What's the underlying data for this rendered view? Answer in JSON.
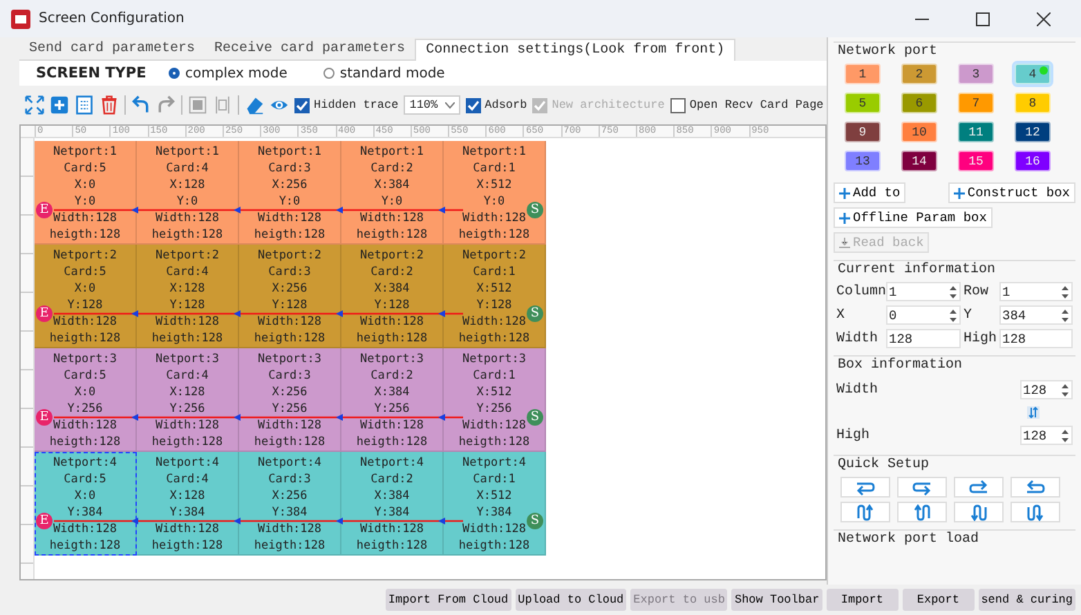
{
  "window": {
    "title": "Screen Configuration"
  },
  "tabs": [
    {
      "label": "Send card parameters",
      "selected": false
    },
    {
      "label": "Receive card parameters",
      "selected": false
    },
    {
      "label": "Connection settings(Look from front)",
      "selected": true
    }
  ],
  "screen_type": {
    "label": "SCREEN TYPE",
    "options": [
      {
        "label": "complex mode",
        "selected": true
      },
      {
        "label": "standard mode",
        "selected": false
      }
    ]
  },
  "toolbar": {
    "tools": [
      {
        "kind": "fit",
        "disabled": false
      },
      {
        "kind": "add",
        "disabled": false
      },
      {
        "kind": "grid",
        "disabled": false
      },
      {
        "kind": "delete",
        "disabled": false
      },
      {
        "kind": "undo",
        "disabled": false
      },
      {
        "kind": "redo",
        "disabled": true
      },
      {
        "kind": "align",
        "disabled": true
      },
      {
        "kind": "distribute",
        "disabled": true
      },
      {
        "kind": "eraser",
        "disabled": false
      },
      {
        "kind": "eye",
        "disabled": false
      }
    ],
    "options": [
      {
        "kind": "checkbox",
        "label": "Hidden trace",
        "checked": true,
        "disabled": false
      },
      {
        "kind": "select",
        "value": "110%"
      },
      {
        "kind": "checkbox",
        "label": "Adsorb",
        "checked": true,
        "disabled": false
      },
      {
        "kind": "checkbox",
        "label": "New architecture",
        "checked": true,
        "disabled": true
      },
      {
        "kind": "checkbox",
        "label": "Open Recv Card Page",
        "checked": false,
        "disabled": false
      }
    ]
  },
  "ruler": {
    "ticks": [
      "0",
      "50",
      "100",
      "150",
      "200",
      "250",
      "300",
      "350",
      "400",
      "450",
      "500",
      "550",
      "600",
      "650",
      "700",
      "750",
      "800",
      "850",
      "900",
      "950"
    ]
  },
  "canvas": {
    "rows": [
      {
        "color": "#fc9c69",
        "start": "S",
        "end": "E",
        "cells": [
          {
            "lines": [
              "Netport:1",
              "Card:5",
              "X:0",
              "Y:0",
              "Width:128",
              "heigth:128"
            ],
            "selected": false
          },
          {
            "lines": [
              "Netport:1",
              "Card:4",
              "X:128",
              "Y:0",
              "Width:128",
              "heigth:128"
            ],
            "selected": false
          },
          {
            "lines": [
              "Netport:1",
              "Card:3",
              "X:256",
              "Y:0",
              "Width:128",
              "heigth:128"
            ],
            "selected": false
          },
          {
            "lines": [
              "Netport:1",
              "Card:2",
              "X:384",
              "Y:0",
              "Width:128",
              "heigth:128"
            ],
            "selected": false
          },
          {
            "lines": [
              "Netport:1",
              "Card:1",
              "X:512",
              "Y:0",
              "Width:128",
              "heigth:128"
            ],
            "selected": false
          }
        ]
      },
      {
        "color": "#cc9933",
        "start": "S",
        "end": "E",
        "cells": [
          {
            "lines": [
              "Netport:2",
              "Card:5",
              "X:0",
              "Y:128",
              "Width:128",
              "heigth:128"
            ],
            "selected": false
          },
          {
            "lines": [
              "Netport:2",
              "Card:4",
              "X:128",
              "Y:128",
              "Width:128",
              "heigth:128"
            ],
            "selected": false
          },
          {
            "lines": [
              "Netport:2",
              "Card:3",
              "X:256",
              "Y:128",
              "Width:128",
              "heigth:128"
            ],
            "selected": false
          },
          {
            "lines": [
              "Netport:2",
              "Card:2",
              "X:384",
              "Y:128",
              "Width:128",
              "heigth:128"
            ],
            "selected": false
          },
          {
            "lines": [
              "Netport:2",
              "Card:1",
              "X:512",
              "Y:128",
              "Width:128",
              "heigth:128"
            ],
            "selected": false
          }
        ]
      },
      {
        "color": "#cc99cc",
        "start": "S",
        "end": "E",
        "cells": [
          {
            "lines": [
              "Netport:3",
              "Card:5",
              "X:0",
              "Y:256",
              "Width:128",
              "heigth:128"
            ],
            "selected": false
          },
          {
            "lines": [
              "Netport:3",
              "Card:4",
              "X:128",
              "Y:256",
              "Width:128",
              "heigth:128"
            ],
            "selected": false
          },
          {
            "lines": [
              "Netport:3",
              "Card:3",
              "X:256",
              "Y:256",
              "Width:128",
              "heigth:128"
            ],
            "selected": false
          },
          {
            "lines": [
              "Netport:3",
              "Card:2",
              "X:384",
              "Y:256",
              "Width:128",
              "heigth:128"
            ],
            "selected": false
          },
          {
            "lines": [
              "Netport:3",
              "Card:1",
              "X:512",
              "Y:256",
              "Width:128",
              "heigth:128"
            ],
            "selected": false
          }
        ]
      },
      {
        "color": "#66cccc",
        "start": "S",
        "end": "E",
        "cells": [
          {
            "lines": [
              "Netport:4",
              "Card:5",
              "X:0",
              "Y:384",
              "Width:128",
              "heigth:128"
            ],
            "selected": true
          },
          {
            "lines": [
              "Netport:4",
              "Card:4",
              "X:128",
              "Y:384",
              "Width:128",
              "heigth:128"
            ],
            "selected": false
          },
          {
            "lines": [
              "Netport:4",
              "Card:3",
              "X:256",
              "Y:384",
              "Width:128",
              "heigth:128"
            ],
            "selected": false
          },
          {
            "lines": [
              "Netport:4",
              "Card:2",
              "X:384",
              "Y:384",
              "Width:128",
              "heigth:128"
            ],
            "selected": false
          },
          {
            "lines": [
              "Netport:4",
              "Card:1",
              "X:512",
              "Y:384",
              "Width:128",
              "heigth:128"
            ],
            "selected": false
          }
        ]
      }
    ]
  },
  "network_port": {
    "title": "Network port",
    "ports": [
      {
        "label": "1",
        "color": "#ff9966",
        "selected": false
      },
      {
        "label": "2",
        "color": "#cc9933",
        "selected": false
      },
      {
        "label": "3",
        "color": "#cc99cc",
        "selected": false
      },
      {
        "label": "4",
        "color": "#66cccc",
        "selected": true
      },
      {
        "label": "5",
        "color": "#99cc00",
        "selected": false
      },
      {
        "label": "6",
        "color": "#999900",
        "selected": false
      },
      {
        "label": "7",
        "color": "#ff9900",
        "selected": false
      },
      {
        "label": "8",
        "color": "#ffcc00",
        "selected": false
      },
      {
        "label": "9",
        "color": "#7f3f3f",
        "selected": false
      },
      {
        "label": "10",
        "color": "#ff7f3f",
        "selected": false
      },
      {
        "label": "11",
        "color": "#007f7f",
        "selected": false
      },
      {
        "label": "12",
        "color": "#003f7f",
        "selected": false
      },
      {
        "label": "13",
        "color": "#7f7fff",
        "selected": false
      },
      {
        "label": "14",
        "color": "#7f003f",
        "selected": false
      },
      {
        "label": "15",
        "color": "#ff007f",
        "selected": false
      },
      {
        "label": "16",
        "color": "#7f00ff",
        "selected": false
      }
    ],
    "buttons": [
      {
        "label": "Add to",
        "kind": "plus",
        "disabled": false
      },
      {
        "label": "Construct box",
        "kind": "plus",
        "disabled": false
      },
      {
        "label": "Offline Param box",
        "kind": "plus",
        "disabled": false
      },
      {
        "label": "Read back",
        "kind": "download",
        "disabled": true
      }
    ]
  },
  "current_information": {
    "title": "Current information",
    "fields": [
      {
        "label": "Column",
        "value": "1",
        "kind": "spin"
      },
      {
        "label": "Row",
        "value": "1",
        "kind": "spin"
      },
      {
        "label": "X",
        "value": "0",
        "kind": "spin"
      },
      {
        "label": "Y",
        "value": "384",
        "kind": "spin"
      },
      {
        "label": "Width",
        "value": "128",
        "kind": "text"
      },
      {
        "label": "High",
        "value": "128",
        "kind": "text"
      }
    ]
  },
  "box_information": {
    "title": "Box information",
    "width": {
      "label": "Width",
      "value": "128"
    },
    "high": {
      "label": "High",
      "value": "128"
    }
  },
  "quick_setup": {
    "title": "Quick Setup",
    "modes": [
      {
        "kind": "h1"
      },
      {
        "kind": "h2"
      },
      {
        "kind": "h3"
      },
      {
        "kind": "h4"
      },
      {
        "kind": "v1"
      },
      {
        "kind": "v2"
      },
      {
        "kind": "v3"
      },
      {
        "kind": "v4"
      }
    ]
  },
  "network_port_load": {
    "title": "Network port load"
  },
  "bottom_buttons": [
    {
      "label": "Import From Cloud",
      "disabled": false
    },
    {
      "label": "Upload to Cloud",
      "disabled": false
    },
    {
      "label": "Export to usb",
      "disabled": true
    },
    {
      "label": "Show Toolbar",
      "disabled": false
    },
    {
      "label": "Import",
      "disabled": false
    },
    {
      "label": "Export",
      "disabled": false
    },
    {
      "label": "send & curing",
      "disabled": false
    }
  ]
}
